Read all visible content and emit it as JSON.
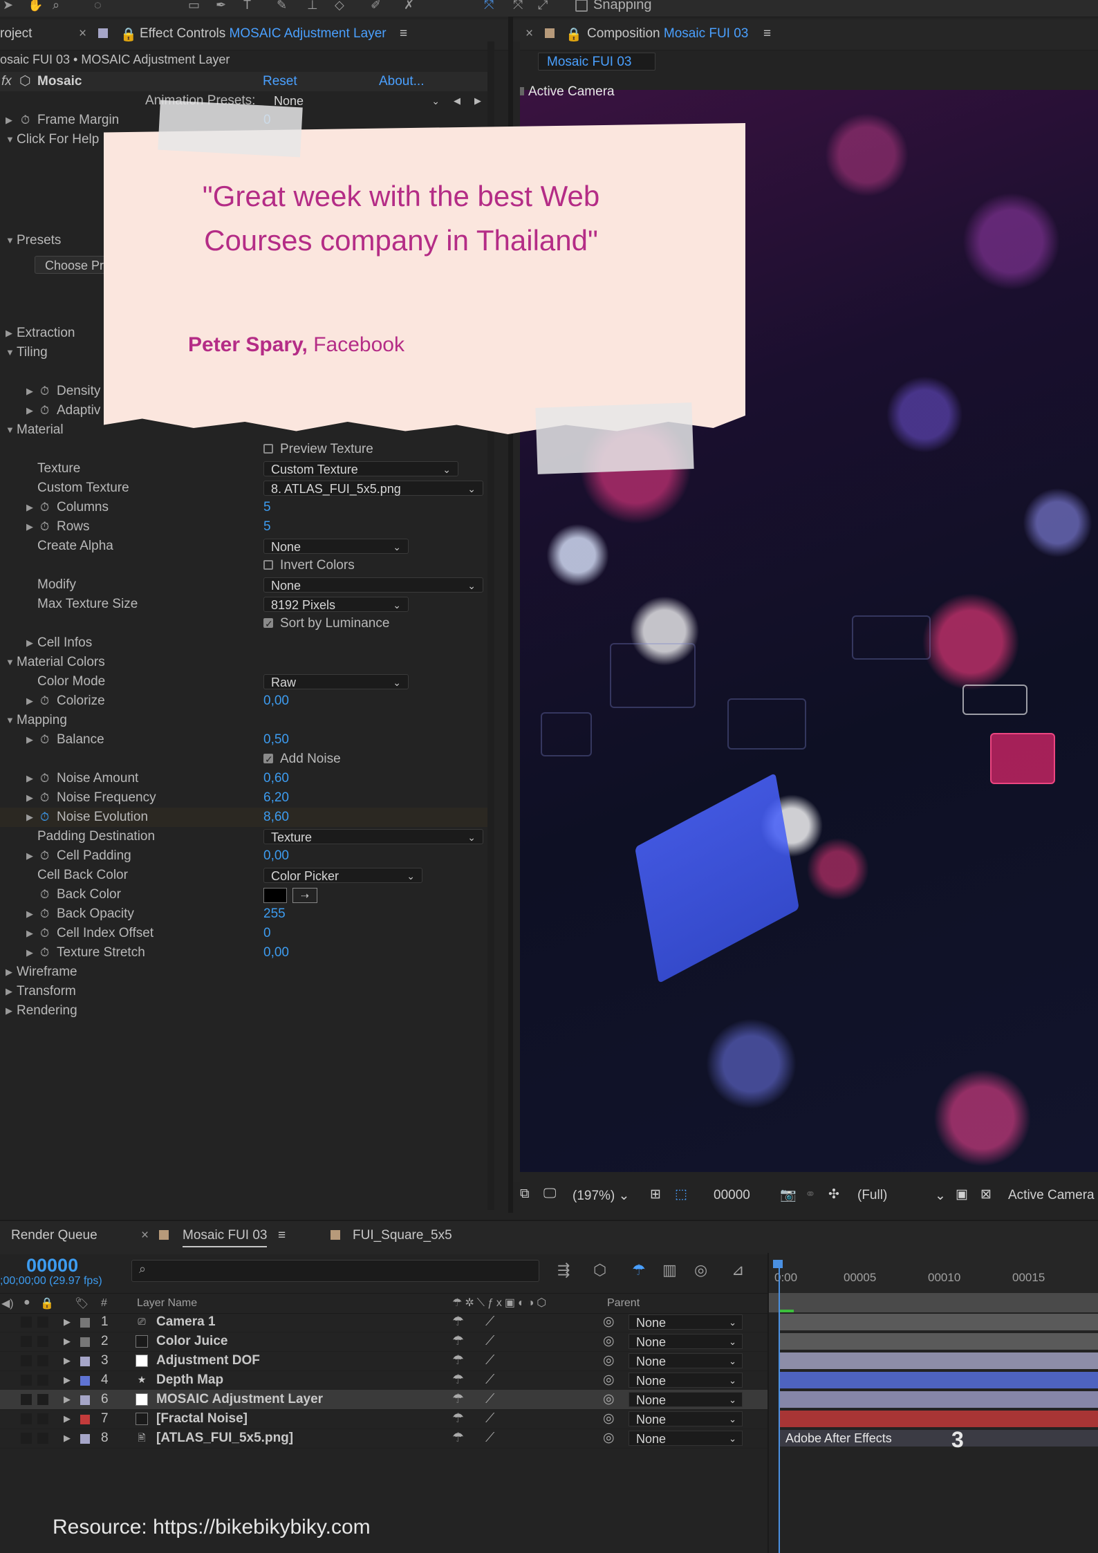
{
  "toolbar": {
    "snapping_label": "Snapping"
  },
  "effect_panel": {
    "project_tab": "roject",
    "tab_prefix": "Effect Controls",
    "tab_layer": "MOSAIC Adjustment Layer",
    "breadcrumb": "osaic FUI 03 • MOSAIC Adjustment Layer",
    "effect_name": "Mosaic",
    "reset": "Reset",
    "about": "About...",
    "animation_presets_label": "Animation Presets:",
    "animation_presets_value": "None",
    "rows": {
      "frame_margin": "Frame Margin",
      "frame_margin_val": "0",
      "click_for_help": "Click For Help",
      "presets": "Presets",
      "choose_preset": "Choose Pr",
      "extraction": "Extraction",
      "tiling": "Tiling",
      "density": "Density",
      "adaptive": "Adaptiv",
      "material": "Material",
      "preview_texture": "Preview Texture",
      "texture": "Texture",
      "texture_val": "Custom Texture",
      "custom_texture": "Custom Texture",
      "custom_texture_val": "8. ATLAS_FUI_5x5.png",
      "columns": "Columns",
      "columns_val": "5",
      "rows_lbl": "Rows",
      "rows_val": "5",
      "create_alpha": "Create Alpha",
      "create_alpha_val": "None",
      "invert_colors": "Invert Colors",
      "modify": "Modify",
      "modify_val": "None",
      "max_texture_size": "Max Texture Size",
      "max_texture_size_val": "8192 Pixels",
      "sort_by_luminance": "Sort by Luminance",
      "cell_infos": "Cell Infos",
      "material_colors": "Material Colors",
      "color_mode": "Color Mode",
      "color_mode_val": "Raw",
      "colorize": "Colorize",
      "colorize_val": "0,00",
      "mapping": "Mapping",
      "balance": "Balance",
      "balance_val": "0,50",
      "add_noise": "Add Noise",
      "noise_amount": "Noise Amount",
      "noise_amount_val": "0,60",
      "noise_frequency": "Noise Frequency",
      "noise_frequency_val": "6,20",
      "noise_evolution": "Noise Evolution",
      "noise_evolution_val": "8,60",
      "padding_destination": "Padding Destination",
      "padding_destination_val": "Texture",
      "cell_padding": "Cell Padding",
      "cell_padding_val": "0,00",
      "cell_back_color": "Cell Back Color",
      "cell_back_color_val": "Color Picker",
      "back_color": "Back Color",
      "back_opacity": "Back Opacity",
      "back_opacity_val": "255",
      "cell_index_offset": "Cell Index Offset",
      "cell_index_offset_val": "0",
      "texture_stretch": "Texture Stretch",
      "texture_stretch_val": "0,00",
      "wireframe": "Wireframe",
      "transform": "Transform",
      "rendering": "Rendering"
    }
  },
  "composition": {
    "tab_prefix": "Composition",
    "tab_name": "Mosaic FUI 03",
    "comp_button": "Mosaic FUI 03",
    "active_camera": "Active Camera",
    "footer": {
      "zoom": "(197%)",
      "timecode": "00000",
      "resolution": "(Full)",
      "camera": "Active Camera"
    }
  },
  "note": {
    "quote_line1": "\"Great week with the best Web",
    "quote_line2": "Courses company in Thailand\"",
    "author_name": "Peter Spary,",
    "author_source": " Facebook"
  },
  "timeline": {
    "tabs": [
      "Render Queue",
      "Mosaic FUI 03",
      "FUI_Square_5x5"
    ],
    "timecode": "00000",
    "fps": ";00;00;00 (29.97 fps)",
    "col_num": "#",
    "col_layer_name": "Layer Name",
    "col_parent": "Parent",
    "ruler": [
      "0:00",
      "00005",
      "00010",
      "00015"
    ],
    "layers": [
      {
        "num": "1",
        "name": "Camera 1",
        "parent": "None",
        "label_color": "#777777"
      },
      {
        "num": "2",
        "name": "Color Juice",
        "parent": "None",
        "label_color": "#777777"
      },
      {
        "num": "3",
        "name": "Adjustment DOF",
        "parent": "None",
        "label_color": "#a6a6c8"
      },
      {
        "num": "4",
        "name": "Depth Map",
        "parent": "None",
        "label_color": "#5f74d4"
      },
      {
        "num": "6",
        "name": "MOSAIC Adjustment Layer",
        "parent": "None",
        "label_color": "#a6a6c8"
      },
      {
        "num": "7",
        "name": "[Fractal Noise]",
        "parent": "None",
        "label_color": "#c33b3b"
      },
      {
        "num": "8",
        "name": "[ATLAS_FUI_5x5.png]",
        "parent": "None",
        "label_color": "#a6a6c8"
      }
    ],
    "bar_label": "Adobe After Effects",
    "bar_number": "3"
  },
  "resource": "Resource: https://bikebikybiky.com"
}
